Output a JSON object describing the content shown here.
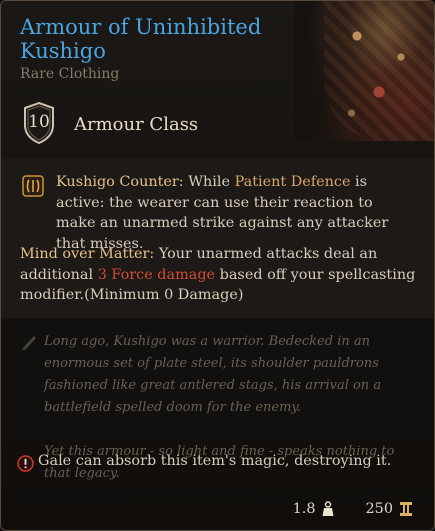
{
  "item": {
    "name": "Armour of Uninhibited Kushigo",
    "rarity": "Rare Clothing",
    "armour_class_value": "10",
    "armour_class_label": "Armour Class"
  },
  "passives": [
    {
      "name": "Kushigo Counter:",
      "text_before": " While ",
      "keyword": "Patient Defence",
      "text_after": " is active: the wearer can use their reaction to make an unarmed strike against any attacker that misses."
    },
    {
      "name": "Mind over Matter:",
      "text_before": " Your unarmed attacks deal an additional ",
      "damage": "3 Force damage",
      "text_after": " based off your spellcasting modifier.(Minimum 0 Damage)"
    }
  ],
  "lore": [
    "Long ago, Kushigo was a warrior. Bedecked in an enormous set of plate steel, its shoulder pauldrons fashioned like great antlered stags, his arrival on a battlefield spelled doom for the enemy.",
    "Yet this armour - so light and fine - speaks nothing to that legacy."
  ],
  "warning": "Gale can absorb this item's magic, destroying it.",
  "footer": {
    "weight": "1.8",
    "weight_icon": "weight-icon",
    "value": "250",
    "value_icon": "gold-icon"
  },
  "colors": {
    "title": "#4aa6e2",
    "rarity": "#8a7a68",
    "keyword": "#e2c38c",
    "damage": "#d34a35",
    "lore": "#6a5f54"
  }
}
